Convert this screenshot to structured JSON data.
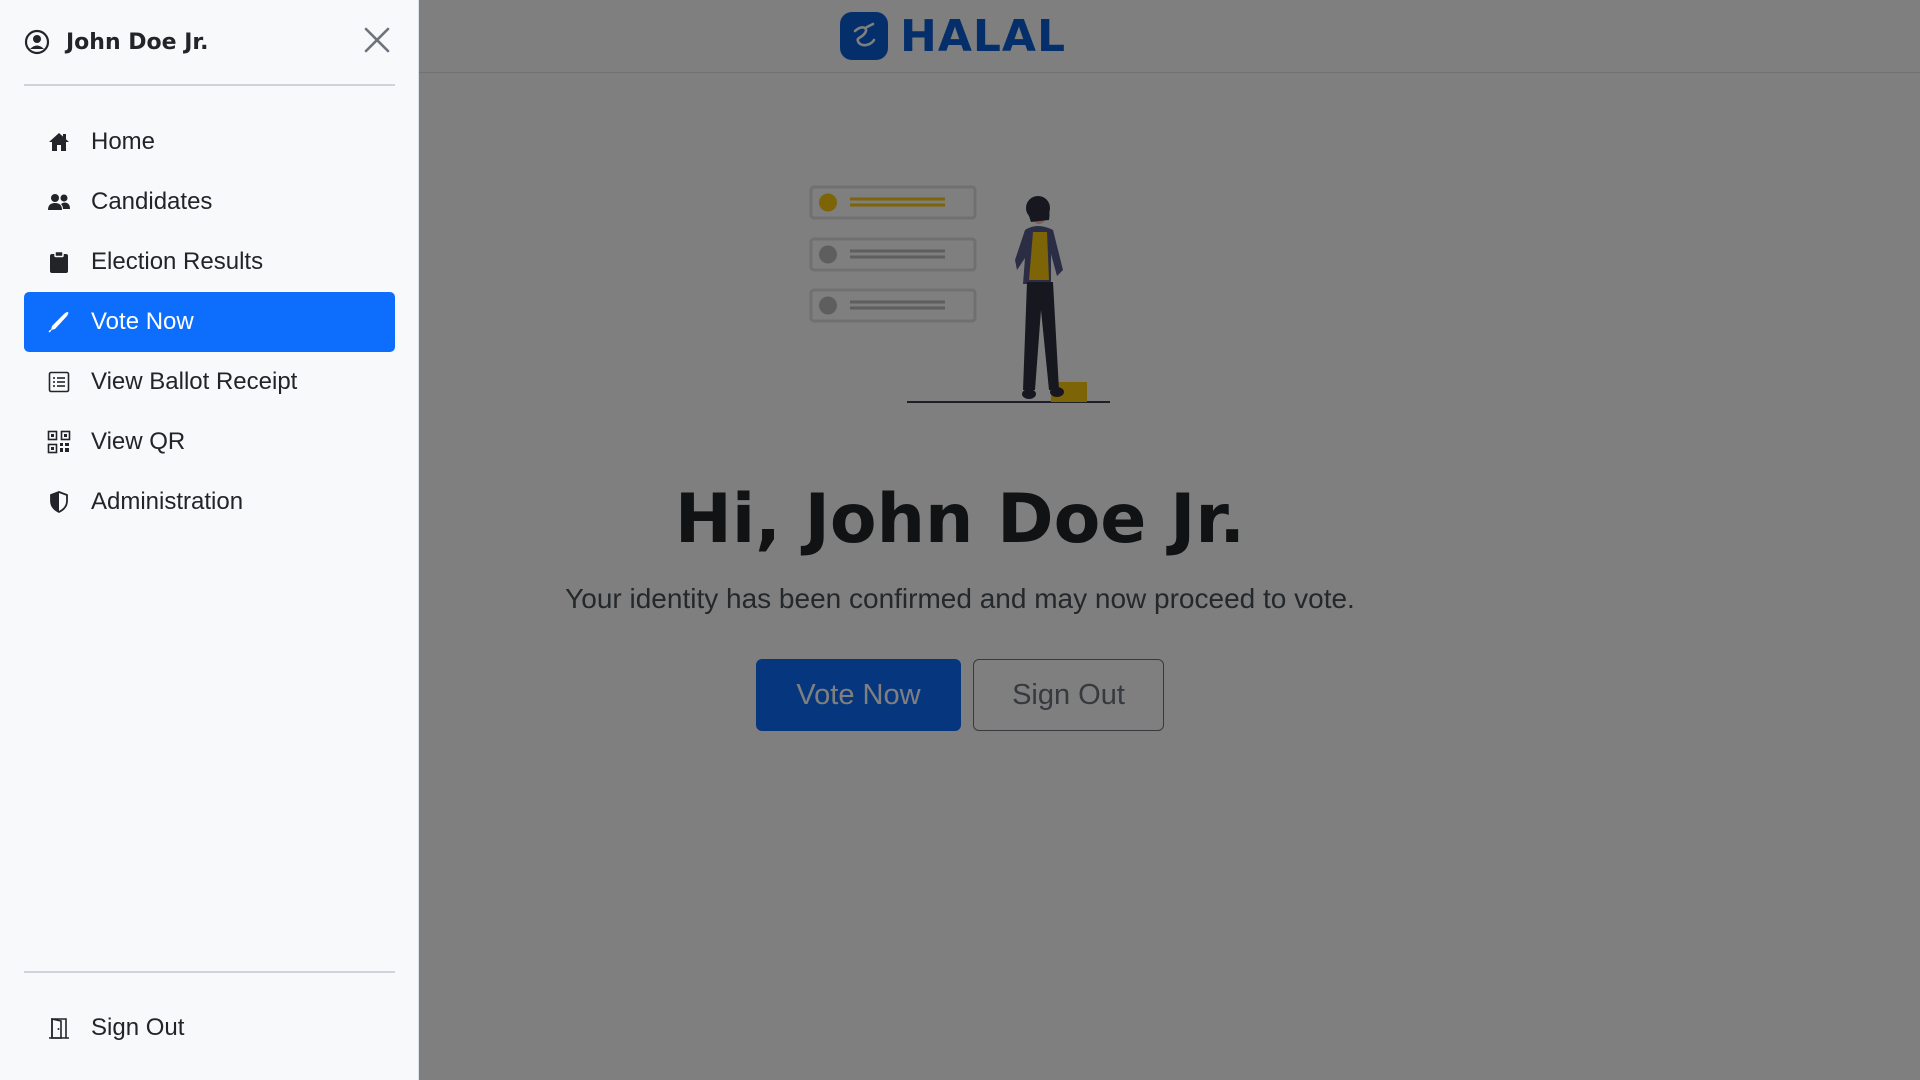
{
  "brand": {
    "name": "HALAL",
    "primary_color": "#0d6efd"
  },
  "hero": {
    "title": "Hi, John Doe Jr.",
    "subtitle": "Your identity has been confirmed and may now proceed to vote.",
    "vote_button": "Vote Now",
    "signout_button": "Sign Out"
  },
  "sidebar": {
    "user_name": "John Doe Jr.",
    "close_icon": "close-icon",
    "items": [
      {
        "label": "Home",
        "icon": "home-icon"
      },
      {
        "label": "Candidates",
        "icon": "people-icon"
      },
      {
        "label": "Election Results",
        "icon": "clipboard-icon"
      },
      {
        "label": "Vote Now",
        "icon": "pen-icon",
        "active": true
      },
      {
        "label": "View Ballot Receipt",
        "icon": "receipt-icon"
      },
      {
        "label": "View QR",
        "icon": "qr-icon"
      },
      {
        "label": "Administration",
        "icon": "shield-icon"
      }
    ],
    "footer": {
      "label": "Sign Out",
      "icon": "door-icon"
    }
  },
  "overlay_color": "rgba(0,0,0,0.5)"
}
